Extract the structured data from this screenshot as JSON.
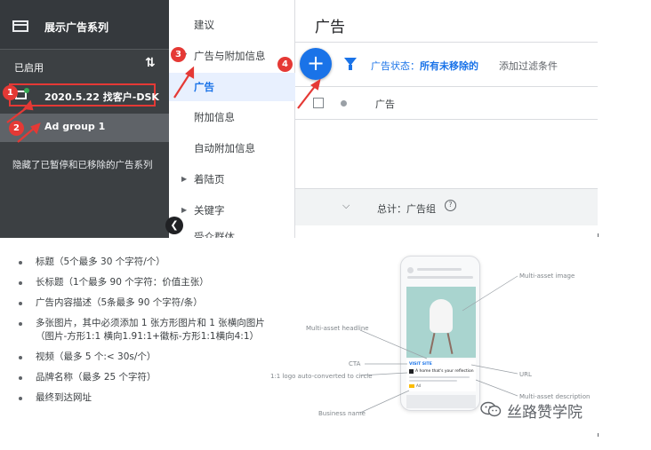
{
  "sidebar": {
    "campaign_label": "展示广告系列",
    "enabled_label": "已启用",
    "campaign_name": "2020.5.22 找客户-DSK",
    "ad_group_name": "Ad group 1",
    "hidden_note": "隐藏了已暂停和已移除的广告系列"
  },
  "nav": {
    "items": [
      "建议",
      "广告与附加信息",
      "广告",
      "附加信息",
      "自动附加信息",
      "着陆页",
      "关键字"
    ],
    "partial_item": "受众群体"
  },
  "main": {
    "title": "广告",
    "filter_prefix": "广告状态：",
    "filter_value": "所有未移除的",
    "add_filter": "添加过滤条件",
    "column_ad": "广告",
    "total_label": "总计：广告组"
  },
  "markers": [
    "1",
    "2",
    "3",
    "4"
  ],
  "specs": [
    "标题（5个最多 30 个字符/个）",
    "长标题（1个最多 90 个字符：价值主张）",
    "广告内容描述（5条最多 90 个字符/条）",
    "多张图片，其中必须添加 1 张方形图片和 1 张横向图片（图片-方形1:1 横向1.91:1+徽标-方形1:1横向4:1）",
    "视频（最多 5 个:< 30s/个）",
    "品牌名称（最多 25 个字符）",
    "最终到达网址"
  ],
  "phone": {
    "cta_label": "VISIT SITE",
    "headline_text": "A home that's your reflection",
    "ad_badge": "Ad"
  },
  "callouts": {
    "multi_asset_image": "Multi-asset image",
    "multi_asset_headline": "Multi-asset headline",
    "cta": "CTA",
    "logo": "1:1 logo auto-converted to circle",
    "url": "URL",
    "description": "Multi-asset description",
    "business_name": "Business name"
  },
  "brand": "丝路赞学院",
  "colors": {
    "sidebar_dark": "#3c4043",
    "accent_blue": "#1a73e8",
    "marker_red": "#e53935"
  }
}
